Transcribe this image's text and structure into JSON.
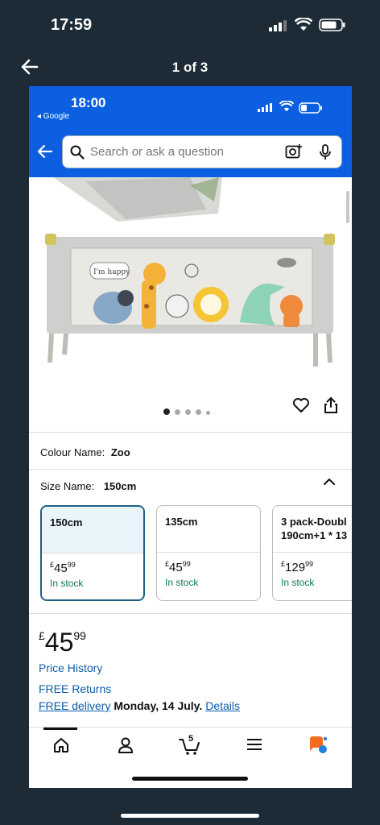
{
  "outer_status": {
    "time": "17:59"
  },
  "viewer": {
    "counter": "1 of 3"
  },
  "inner_status": {
    "time": "18:00",
    "back_app": "◂ Google"
  },
  "search": {
    "placeholder": "Search or ask a question"
  },
  "product_image": {
    "speech_text": "I'm happy",
    "carousel_dots": 5,
    "active_dot": 0
  },
  "colour": {
    "label": "Colour Name:",
    "value": "Zoo"
  },
  "size": {
    "label": "Size Name:",
    "value": "150cm"
  },
  "size_options": [
    {
      "name": "150cm",
      "currency": "£",
      "whole": "45",
      "fraction": "99",
      "stock": "In stock",
      "selected": true
    },
    {
      "name": "135cm",
      "currency": "£",
      "whole": "45",
      "fraction": "99",
      "stock": "In stock",
      "selected": false
    },
    {
      "name": "3 pack-Doubl 190cm+1 * 13",
      "currency": "£",
      "whole": "129",
      "fraction": "99",
      "stock": "In stock",
      "selected": false
    }
  ],
  "price": {
    "currency": "£",
    "whole": "45",
    "fraction": "99"
  },
  "links": {
    "price_history": "Price History",
    "free_returns": "FREE Returns",
    "free_delivery": "FREE delivery",
    "delivery_date": "Monday, 14 July.",
    "details": "Details"
  },
  "tabbar": {
    "cart_count": "5",
    "active_tab": "home"
  },
  "colors": {
    "amazon_blue": "#0b5fe0",
    "link": "#0b5ca8",
    "stock_green": "#0a7a5a",
    "selected_border": "#1e5f84"
  }
}
